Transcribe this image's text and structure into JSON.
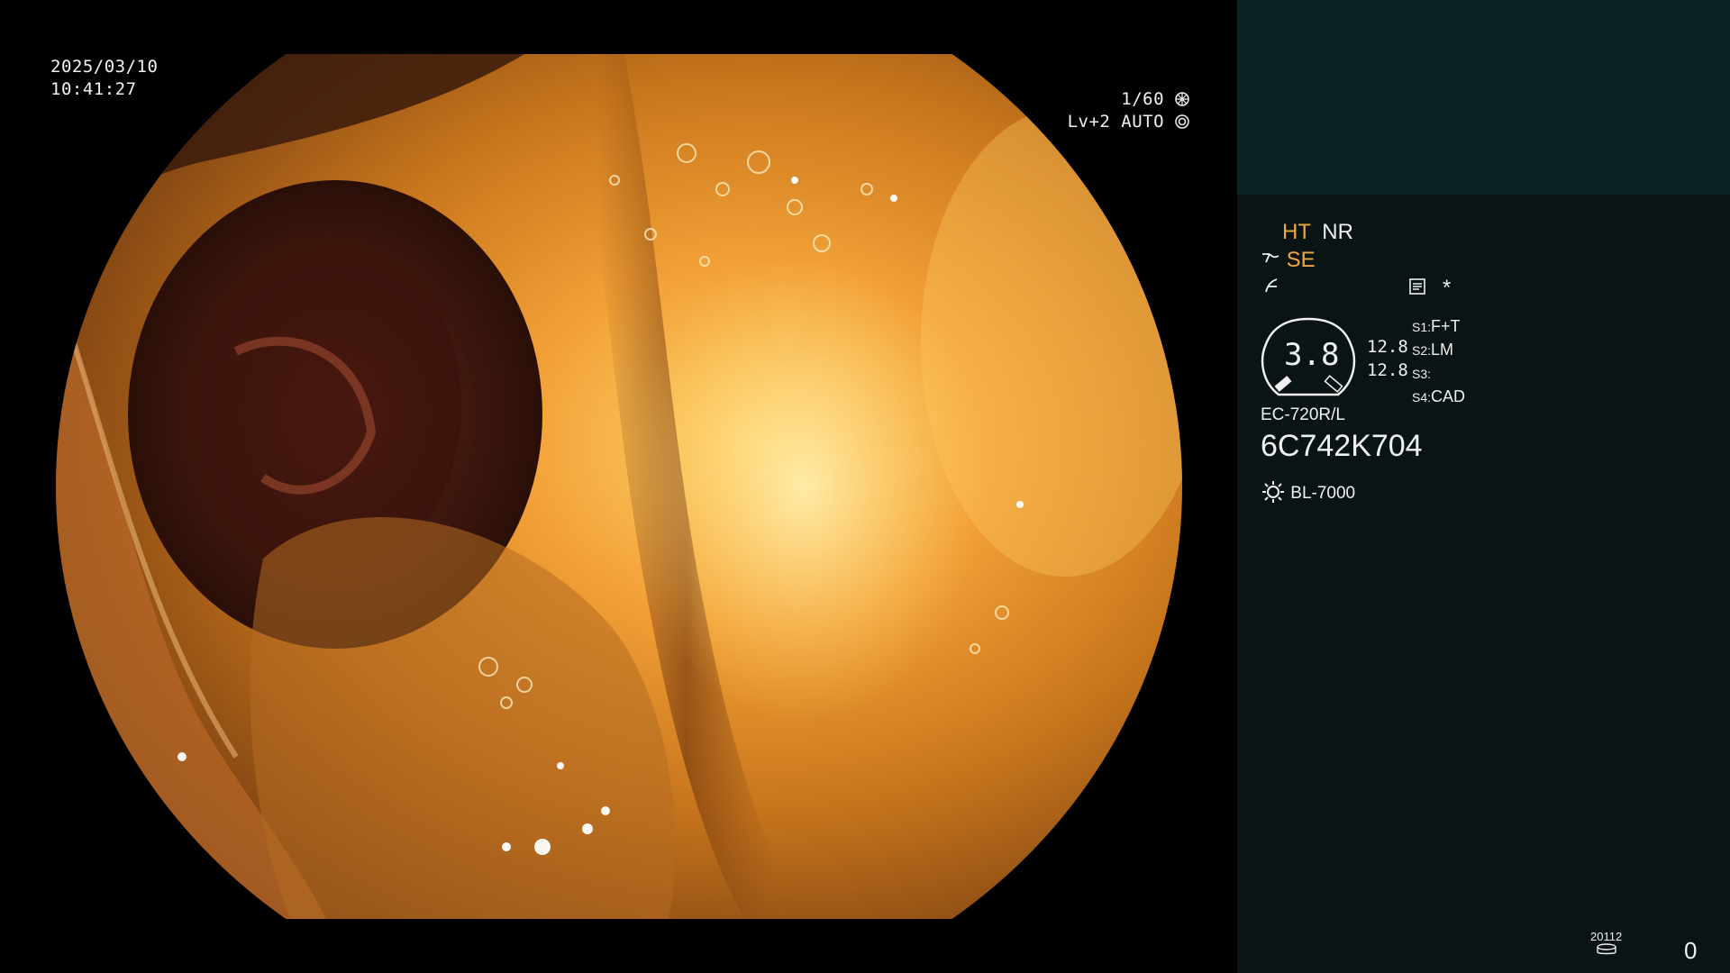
{
  "overlay": {
    "date": "2025/03/10",
    "time": "10:41:27",
    "shutter": "1/60",
    "level_mode": "Lv+2 AUTO"
  },
  "panel": {
    "mode_ht": "HT",
    "mode_nr": "NR",
    "mode_se": "SE",
    "asterisk": "*",
    "dial_value": "3.8",
    "dial_right_1": "12.8",
    "dial_right_2": "12.8",
    "switches": [
      {
        "key": "S1:",
        "value": "F+T"
      },
      {
        "key": "S2:",
        "value": "LM"
      },
      {
        "key": "S3:",
        "value": ""
      },
      {
        "key": "S4:",
        "value": "CAD"
      }
    ],
    "scope_model": "EC-720R/L",
    "scope_serial": "6C742K704",
    "light_source": "BL-7000",
    "storage_count": "20112",
    "counter": "0"
  },
  "colors": {
    "panel_bg": "#0a1414",
    "panel_top": "#0d2224",
    "accent": "#f0a83c"
  }
}
